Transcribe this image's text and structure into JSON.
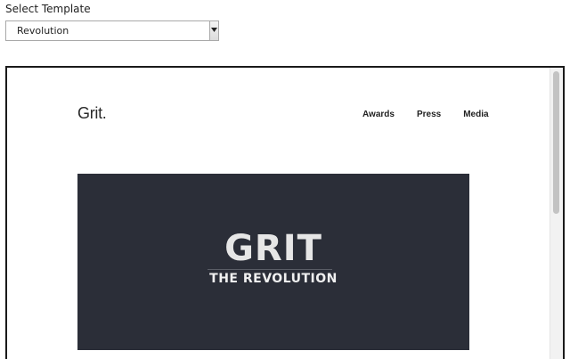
{
  "selector": {
    "label": "Select Template",
    "selected": "Revolution"
  },
  "preview": {
    "logo": "Grit.",
    "nav": [
      {
        "label": "Awards"
      },
      {
        "label": "Press"
      },
      {
        "label": "Media"
      }
    ],
    "hero": {
      "title": "GRIT",
      "subtitle": "THE REVOLUTION",
      "background": "#2b2e38"
    }
  }
}
